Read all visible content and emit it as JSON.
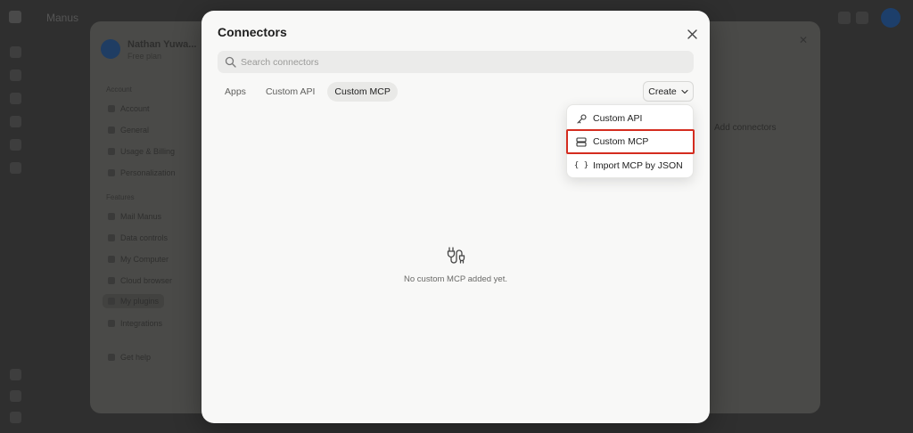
{
  "background_app": {
    "title": "Manus",
    "settings": {
      "user_name": "Nathan Yuwa...",
      "plan": "Free plan",
      "sections": [
        "Account",
        "Features"
      ],
      "items": [
        "Account",
        "General",
        "Usage & Billing",
        "Personalization",
        "Mail Manus",
        "Data controls",
        "My Computer",
        "Cloud browser",
        "My plugins",
        "Integrations",
        "Get help"
      ],
      "right_text": "Add connectors"
    }
  },
  "modal": {
    "title": "Connectors",
    "search": {
      "placeholder": "Search connectors",
      "value": ""
    },
    "tabs": [
      {
        "label": "Apps",
        "active": false
      },
      {
        "label": "Custom API",
        "active": false
      },
      {
        "label": "Custom MCP",
        "active": true
      }
    ],
    "create_button": {
      "label": "Create"
    },
    "create_menu": [
      {
        "label": "Custom API",
        "icon": "key-icon",
        "highlighted": false
      },
      {
        "label": "Custom MCP",
        "icon": "server-icon",
        "highlighted": true
      },
      {
        "label": "Import MCP by JSON",
        "icon": "braces-icon",
        "highlighted": false
      }
    ],
    "empty_state": {
      "text": "No custom MCP added yet.",
      "icon": "plug-icon"
    }
  },
  "colors": {
    "highlight_border": "#d42c1f",
    "modal_bg": "#f8f8f7",
    "overlay": "#2b2b2b"
  }
}
